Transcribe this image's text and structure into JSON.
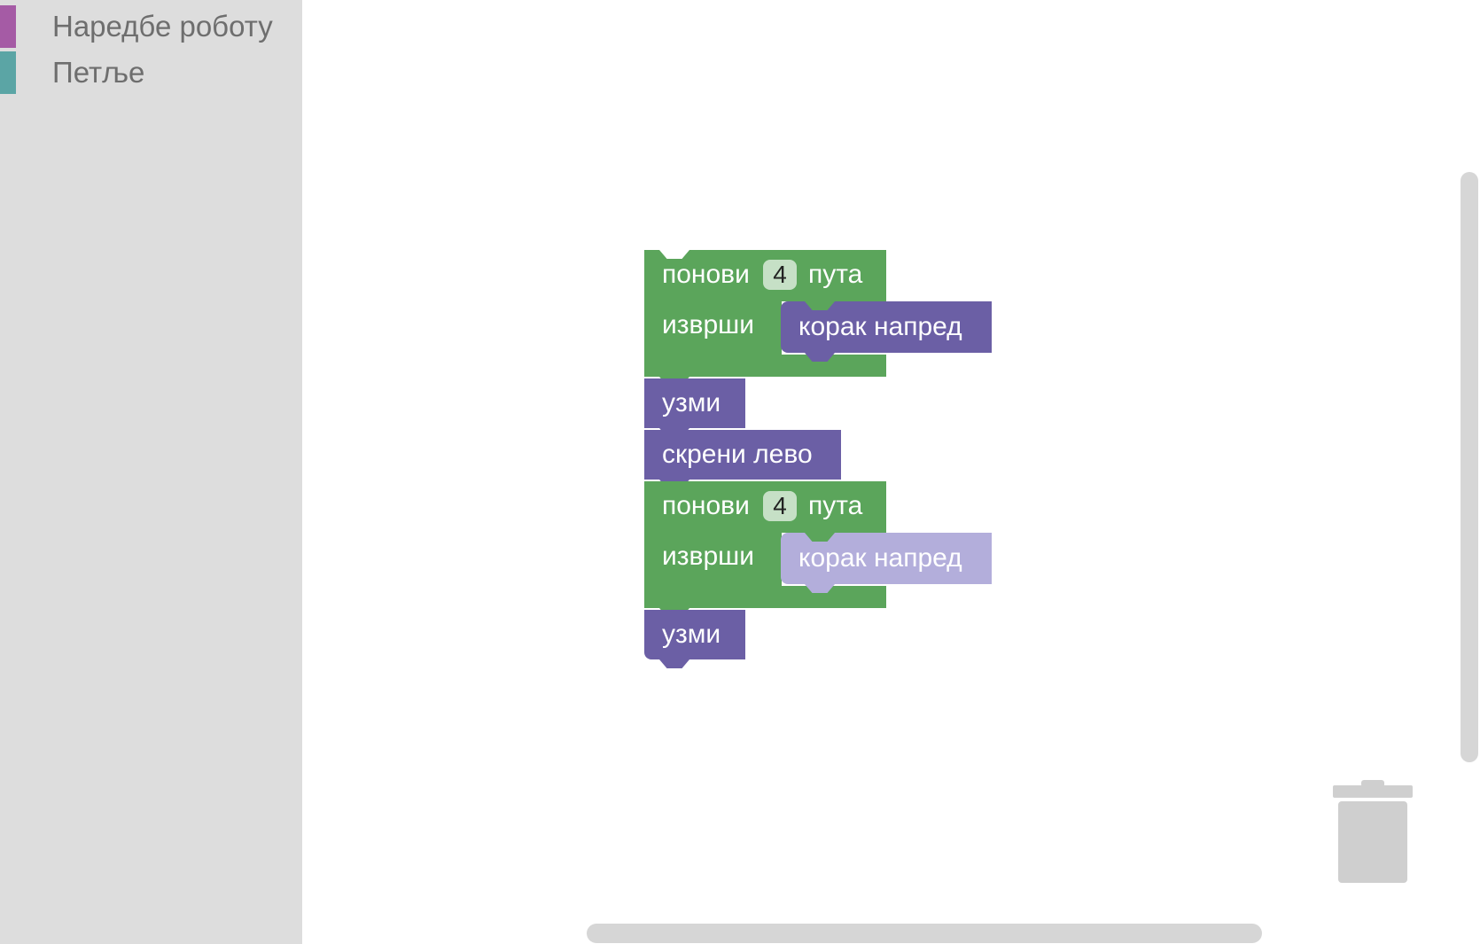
{
  "toolbox": {
    "categories": [
      {
        "label": "Наредбе роботу",
        "color": "#a55ba5"
      },
      {
        "label": "Петље",
        "color": "#5ba5a5"
      }
    ]
  },
  "blocks": {
    "repeat1": {
      "repeat_word": "понови",
      "count": "4",
      "times_word": "пута",
      "do_word": "изврши"
    },
    "step1": {
      "label": "корак напред"
    },
    "take1": {
      "label": "узми"
    },
    "turn": {
      "label": "скрени лево"
    },
    "repeat2": {
      "repeat_word": "понови",
      "count": "4",
      "times_word": "пута",
      "do_word": "изврши"
    },
    "step2": {
      "label": "корак напред"
    },
    "take2": {
      "label": "узми"
    }
  },
  "colors": {
    "loop_block": "#5ba55b",
    "robot_block": "#6b5fa5",
    "disabled_block": "#b3aedb",
    "toolbox_bg": "#dddddd"
  }
}
